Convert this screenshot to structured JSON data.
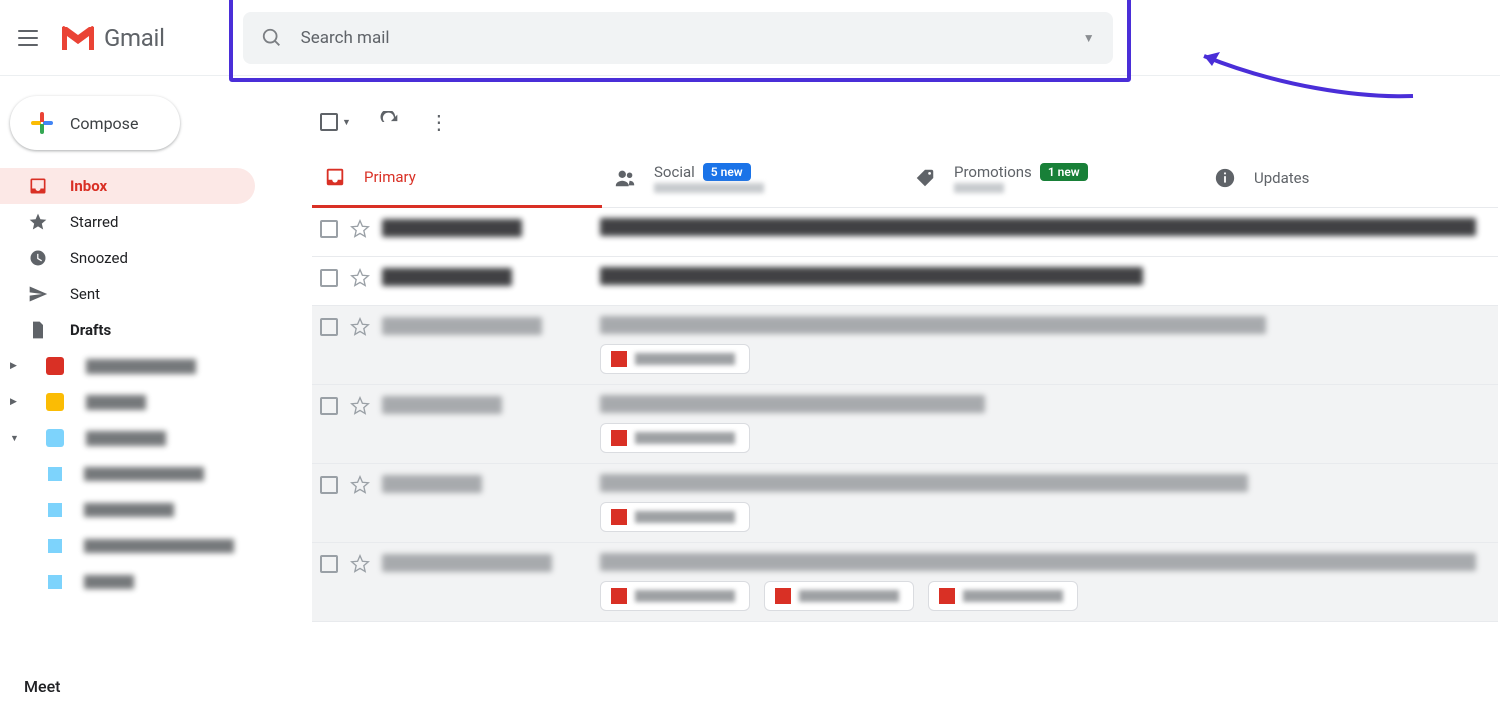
{
  "header": {
    "app_name": "Gmail",
    "search_placeholder": "Search mail"
  },
  "compose_label": "Compose",
  "sidebar": {
    "items": [
      {
        "label": "Inbox",
        "icon": "inbox",
        "active": true,
        "bold": true
      },
      {
        "label": "Starred",
        "icon": "star",
        "active": false,
        "bold": false
      },
      {
        "label": "Snoozed",
        "icon": "clock",
        "active": false,
        "bold": false
      },
      {
        "label": "Sent",
        "icon": "send",
        "active": false,
        "bold": false
      },
      {
        "label": "Drafts",
        "icon": "file",
        "active": false,
        "bold": true
      }
    ],
    "labels": [
      {
        "swatch": "#d93025",
        "expandable": true
      },
      {
        "swatch": "#fbbc04",
        "expandable": true
      },
      {
        "swatch": "#7dd3fc",
        "expandable": true,
        "expanded": true,
        "children": [
          {
            "swatch": "#7dd3fc"
          },
          {
            "swatch": "#7dd3fc"
          },
          {
            "swatch": "#7dd3fc"
          },
          {
            "swatch": "#7dd3fc"
          }
        ]
      }
    ],
    "meet": "Meet"
  },
  "tabs": [
    {
      "label": "Primary",
      "icon": "inbox",
      "active": true
    },
    {
      "label": "Social",
      "icon": "people",
      "badge": "5 new",
      "badge_color": "blue"
    },
    {
      "label": "Promotions",
      "icon": "tag",
      "badge": "1 new",
      "badge_color": "green"
    },
    {
      "label": "Updates",
      "icon": "info"
    }
  ],
  "rows": [
    {
      "unread": true,
      "chips": 0
    },
    {
      "unread": true,
      "chips": 0
    },
    {
      "unread": false,
      "chips": 1
    },
    {
      "unread": false,
      "chips": 1
    },
    {
      "unread": false,
      "chips": 1
    },
    {
      "unread": false,
      "chips": 3
    }
  ]
}
